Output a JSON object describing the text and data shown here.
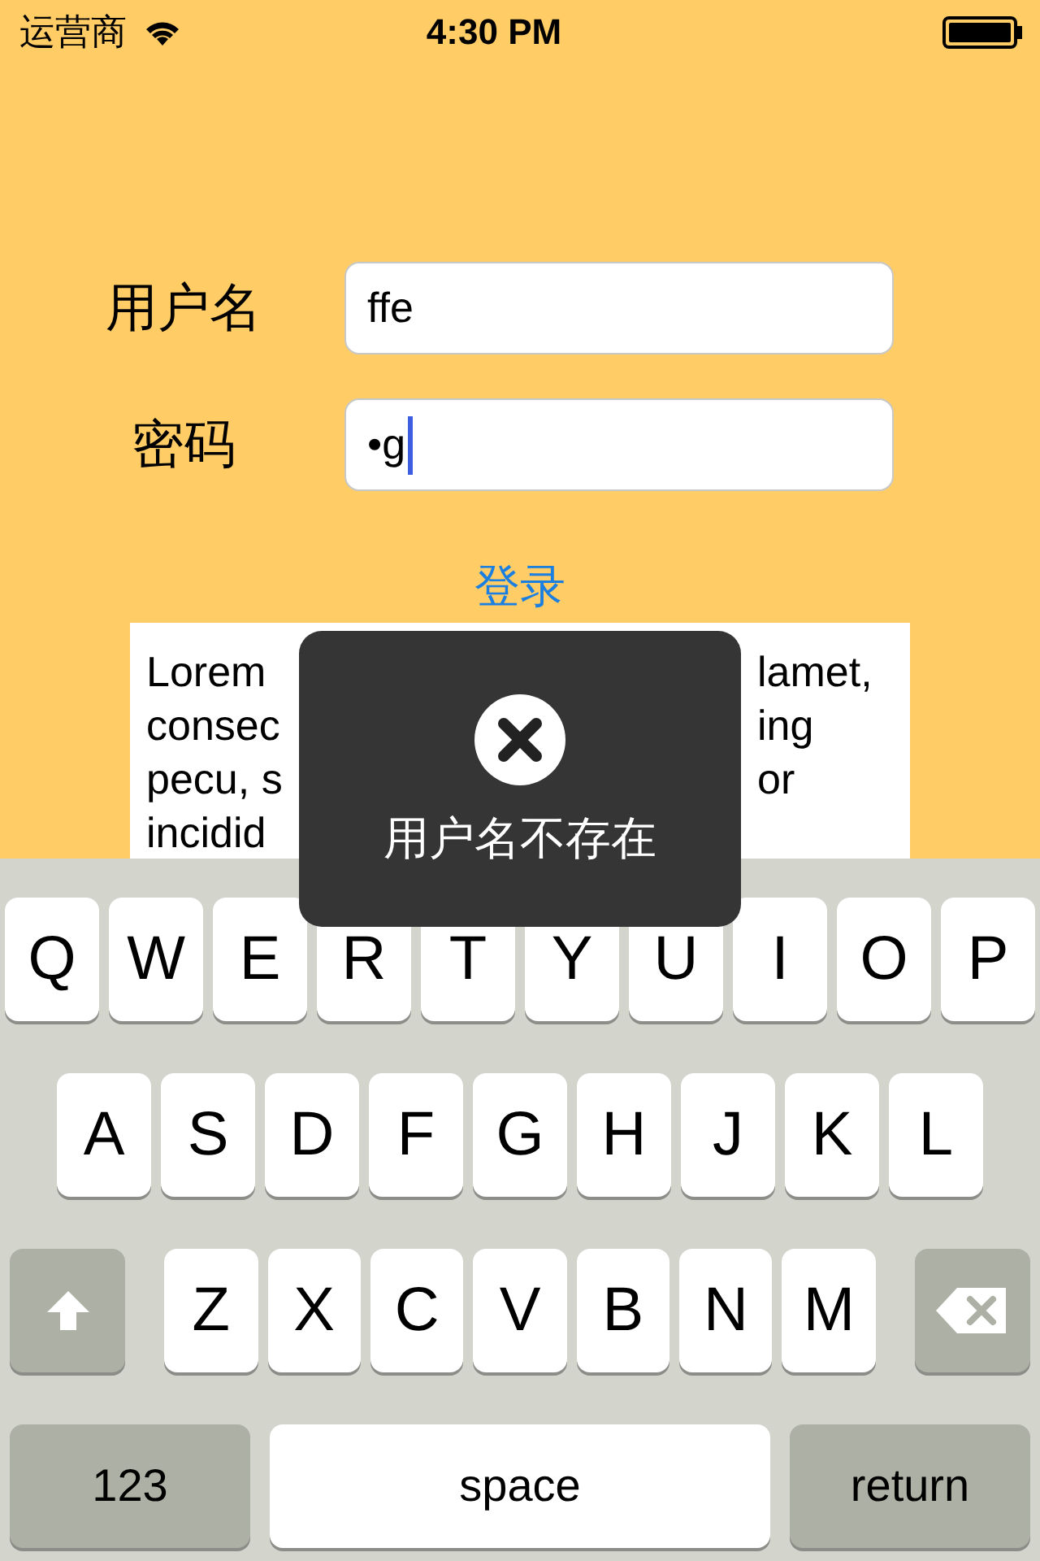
{
  "status_bar": {
    "carrier": "运营商",
    "time": "4:30 PM"
  },
  "form": {
    "fields": [
      {
        "label": "用户名",
        "value": "ffe",
        "focused": false
      },
      {
        "label": "密码",
        "value": "•g",
        "focused": true
      }
    ],
    "login_link": "登录"
  },
  "text_view": {
    "lines": [
      {
        "left": "Lorem",
        "right": "lamet,"
      },
      {
        "left": "consec",
        "right": "ing"
      },
      {
        "left": "pecu, s",
        "right": "or"
      },
      {
        "left": "incidid"
      }
    ]
  },
  "toast": {
    "message": "用户名不存在"
  },
  "keyboard": {
    "rows": [
      {
        "keys": [
          {
            "kind": "letter",
            "label": "Q"
          },
          {
            "kind": "letter",
            "label": "W"
          },
          {
            "kind": "letter",
            "label": "E"
          },
          {
            "kind": "letter",
            "label": "R"
          },
          {
            "kind": "letter",
            "label": "T"
          },
          {
            "kind": "letter",
            "label": "Y"
          },
          {
            "kind": "letter",
            "label": "U"
          },
          {
            "kind": "letter",
            "label": "I"
          },
          {
            "kind": "letter",
            "label": "O"
          },
          {
            "kind": "letter",
            "label": "P"
          }
        ]
      },
      {
        "keys": [
          {
            "kind": "letter",
            "label": "A"
          },
          {
            "kind": "letter",
            "label": "S"
          },
          {
            "kind": "letter",
            "label": "D"
          },
          {
            "kind": "letter",
            "label": "F"
          },
          {
            "kind": "letter",
            "label": "G"
          },
          {
            "kind": "letter",
            "label": "H"
          },
          {
            "kind": "letter",
            "label": "J"
          },
          {
            "kind": "letter",
            "label": "K"
          },
          {
            "kind": "letter",
            "label": "L"
          }
        ]
      },
      {
        "keys": [
          {
            "kind": "shift"
          },
          {
            "kind": "letter",
            "label": "Z"
          },
          {
            "kind": "letter",
            "label": "X"
          },
          {
            "kind": "letter",
            "label": "C"
          },
          {
            "kind": "letter",
            "label": "V"
          },
          {
            "kind": "letter",
            "label": "B"
          },
          {
            "kind": "letter",
            "label": "N"
          },
          {
            "kind": "letter",
            "label": "M"
          },
          {
            "kind": "delete"
          }
        ]
      },
      {
        "keys": [
          {
            "kind": "mode",
            "label": "123"
          },
          {
            "kind": "space",
            "label": "space"
          },
          {
            "kind": "return",
            "label": "return"
          }
        ]
      }
    ]
  }
}
